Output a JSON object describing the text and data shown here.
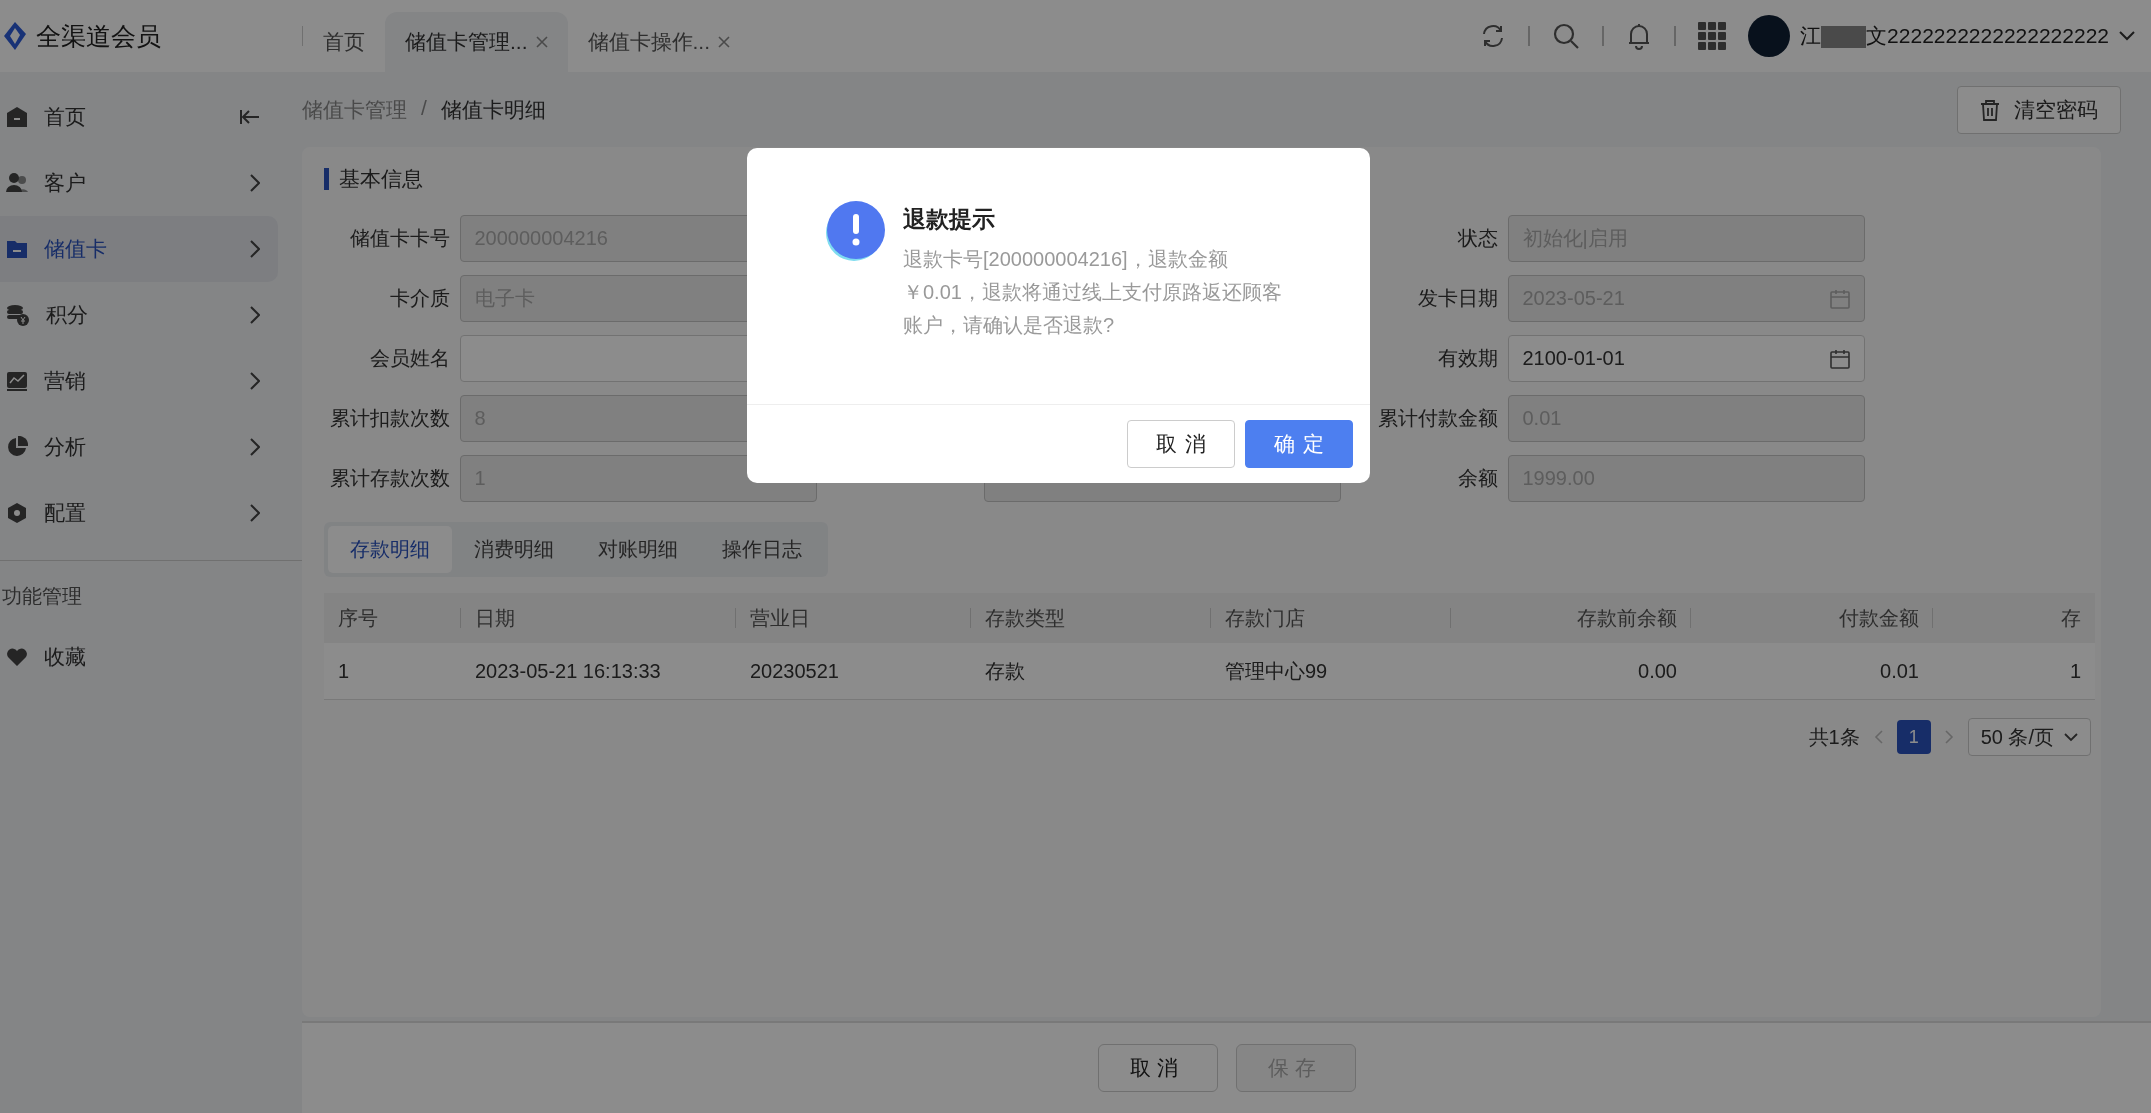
{
  "app": {
    "title": "全渠道会员"
  },
  "header_tabs": [
    {
      "label": "首页",
      "selected": false,
      "closable": false
    },
    {
      "label": "储值卡管理...",
      "selected": true,
      "closable": true
    },
    {
      "label": "储值卡操作...",
      "selected": false,
      "closable": true
    }
  ],
  "user": {
    "name_prefix": "江",
    "name": "文2222222222222222222"
  },
  "sidebar": {
    "items": [
      {
        "label": "首页",
        "selected": false,
        "kind": "collapse"
      },
      {
        "label": "客户",
        "selected": false,
        "kind": "submenu"
      },
      {
        "label": "储值卡",
        "selected": true,
        "kind": "submenu"
      },
      {
        "label": "积分",
        "selected": false,
        "kind": "submenu"
      },
      {
        "label": "营销",
        "selected": false,
        "kind": "submenu"
      },
      {
        "label": "分析",
        "selected": false,
        "kind": "submenu"
      },
      {
        "label": "配置",
        "selected": false,
        "kind": "submenu"
      }
    ],
    "section": "功能管理",
    "section_items": [
      {
        "label": "收藏",
        "selected": false
      }
    ]
  },
  "breadcrumb": {
    "items": [
      "储值卡管理",
      "储值卡明细"
    ],
    "separator": "/"
  },
  "clear_password_button": "清空密码",
  "section_title": "基本信息",
  "fields_left": [
    {
      "label": "储值卡卡号",
      "value": "200000004216",
      "disabled": true,
      "kind": "text"
    },
    {
      "label": "卡介质",
      "value": "电子卡",
      "disabled": true,
      "kind": "text"
    },
    {
      "label": "会员姓名",
      "disabled": false,
      "kind": "text"
    },
    {
      "label": "累计扣款次数",
      "value": "8",
      "disabled": true,
      "kind": "text"
    },
    {
      "label": "累计存款次数",
      "value": "1",
      "disabled": true,
      "kind": "text"
    }
  ],
  "fields_right": [
    {
      "label": "状态",
      "value": "初始化|启用",
      "disabled": true,
      "kind": "text"
    },
    {
      "label": "发卡日期",
      "value": "2023-05-21",
      "disabled": true,
      "kind": "date"
    },
    {
      "label": "有效期",
      "value": "2100-01-01",
      "disabled": false,
      "kind": "date"
    },
    {
      "label": "累计付款金额",
      "value": "0.01",
      "disabled": true,
      "kind": "text"
    },
    {
      "label": "余额",
      "value": "1999.00",
      "disabled": true,
      "kind": "text"
    }
  ],
  "detail_tabs": [
    {
      "label": "存款明细",
      "selected": true
    },
    {
      "label": "消费明细",
      "selected": false
    },
    {
      "label": "对账明细",
      "selected": false
    },
    {
      "label": "操作日志",
      "selected": false
    }
  ],
  "table": {
    "columns": [
      "序号",
      "日期",
      "营业日",
      "存款类型",
      "存款门店",
      "存款前余额",
      "付款金额",
      "存"
    ],
    "rows": [
      [
        "1",
        "2023-05-21 16:13:33",
        "20230521",
        "存款",
        "管理中心99",
        "0.00",
        "0.01",
        "1"
      ]
    ]
  },
  "pagination": {
    "total": "共1条",
    "pages": [
      {
        "label": "1",
        "selected": true
      }
    ],
    "page_size": "50 条/页"
  },
  "footer_buttons": [
    {
      "label": "取消",
      "disabled": false
    },
    {
      "label": "保存",
      "disabled": true
    }
  ],
  "dialog": {
    "title": "退款提示",
    "message": "退款卡号[200000004216]，退款金额￥0.01，退款将通过线上支付原路返还顾客账户，请确认是否退款?",
    "buttons": [
      {
        "label": "取消",
        "kind": "default"
      },
      {
        "label": "确定",
        "kind": "primary"
      }
    ]
  }
}
